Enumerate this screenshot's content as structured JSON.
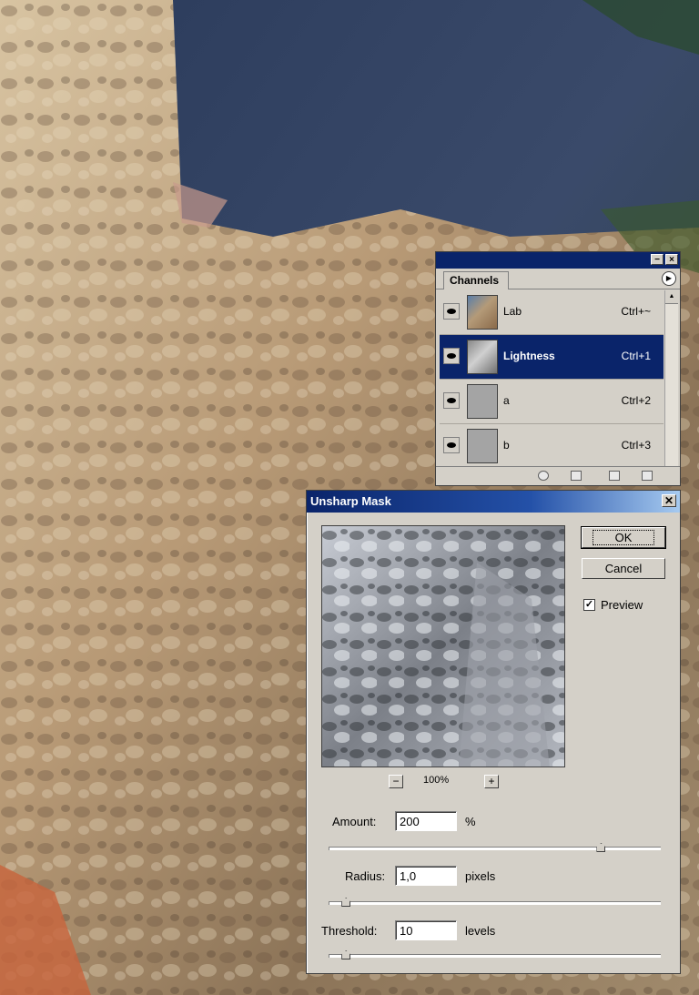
{
  "channels": {
    "tab_label": "Channels",
    "rows": [
      {
        "name": "Lab",
        "shortcut": "Ctrl+~",
        "thumb": "color"
      },
      {
        "name": "Lightness",
        "shortcut": "Ctrl+1",
        "thumb": "gray"
      },
      {
        "name": "a",
        "shortcut": "Ctrl+2",
        "thumb": "flat"
      },
      {
        "name": "b",
        "shortcut": "Ctrl+3",
        "thumb": "flat"
      }
    ],
    "selected_index": 1
  },
  "dialog": {
    "title": "Unsharp Mask",
    "ok_label": "OK",
    "cancel_label": "Cancel",
    "preview_label": "Preview",
    "preview_checked": true,
    "zoom_level": "100%",
    "amount": {
      "label": "Amount:",
      "value": "200",
      "unit": "%",
      "slider_fraction": 0.82
    },
    "radius": {
      "label": "Radius:",
      "value": "1,0",
      "unit": "pixels",
      "slider_fraction": 0.05
    },
    "threshold": {
      "label": "Threshold:",
      "value": "10",
      "unit": "levels",
      "slider_fraction": 0.05
    }
  },
  "icons": {
    "close": "close-icon",
    "minimize": "minimize-icon",
    "palette_menu": "menu-arrow-icon",
    "eye": "eye-icon"
  }
}
